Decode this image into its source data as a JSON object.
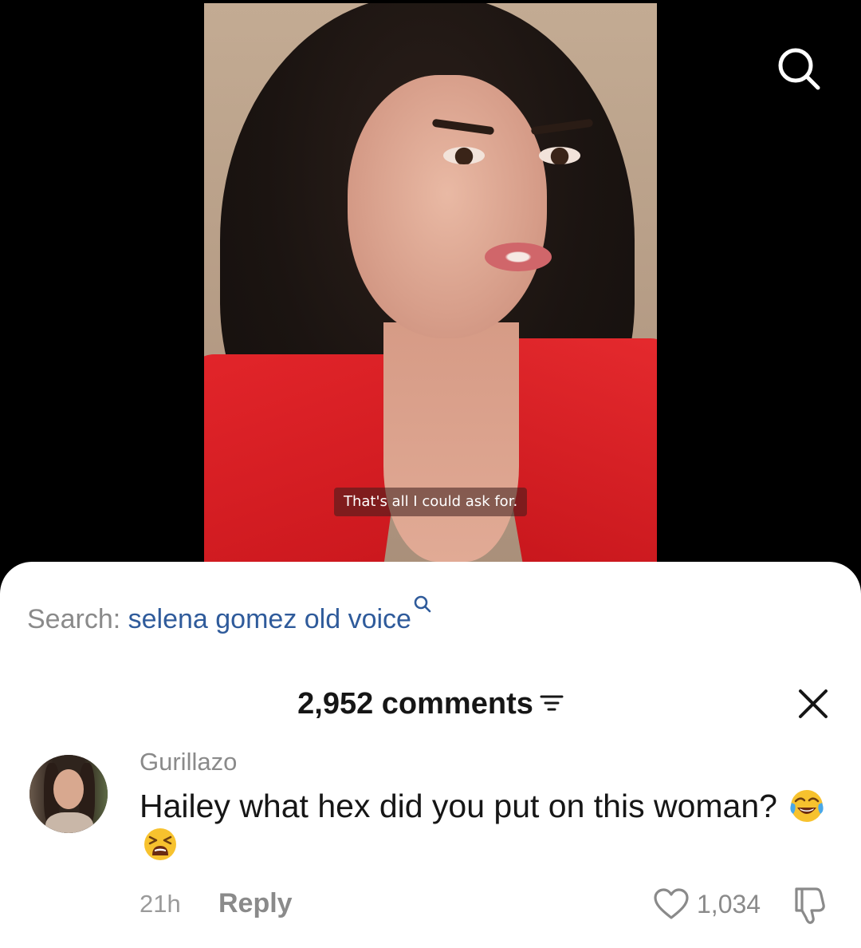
{
  "video": {
    "caption": "That's all I could ask for."
  },
  "top_bar": {
    "search_icon": "search-icon"
  },
  "sheet": {
    "search_prefix": "Search:",
    "search_query": "selena gomez old voice",
    "search_query_icon": "search-icon",
    "comments_count": "2,952",
    "comments_label": "comments",
    "sort_icon": "sort-lines-icon",
    "close_icon": "close-icon"
  },
  "comment": {
    "username": "Gurillazo",
    "text": "Hailey what hex did you put on this woman?",
    "emojis": [
      "face-with-tears-of-joy-emoji",
      "tired-face-emoji"
    ],
    "time": "21h",
    "reply_label": "Reply",
    "like_icon": "heart-outline-icon",
    "like_count": "1,034",
    "dislike_icon": "thumbs-down-icon"
  },
  "colors": {
    "link_blue": "#2f5b9b",
    "muted_gray": "#8a8a8a",
    "text_dark": "#161616",
    "sheet_bg": "#ffffff",
    "page_bg": "#000000"
  }
}
